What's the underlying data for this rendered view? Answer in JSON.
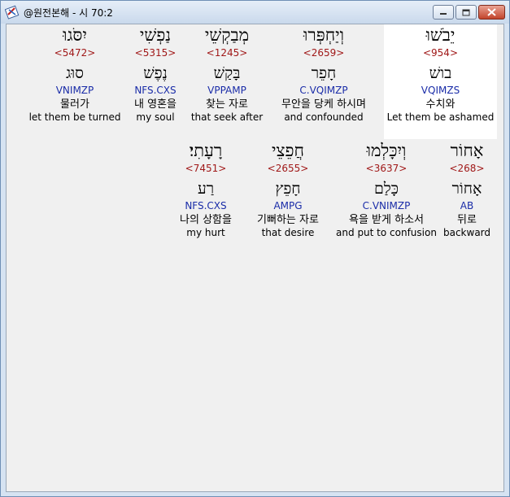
{
  "window": {
    "title": "@원전본해 - 시 70:2",
    "icon": "bible-app-icon",
    "controls": [
      "minimize",
      "maximize",
      "close"
    ]
  },
  "words": [
    {
      "heb": "יֵבֹשׁוּ",
      "strong": "<954>",
      "root": "בושׁ",
      "morph": "VQIMZS",
      "kor": "수치와",
      "eng": "Let them be ashamed",
      "selected": true
    },
    {
      "heb": "וְיַחְפְּרוּ",
      "strong": "<2659>",
      "root": "חָפֵר",
      "morph": "C.VQIMZP",
      "kor": "무안을 당케 하시며",
      "eng": "and confounded"
    },
    {
      "heb": "מְבַקְשֵׁי",
      "strong": "<1245>",
      "root": "בָּקַשׁ",
      "morph": "VPPAMP",
      "kor": "찾는 자로",
      "eng": "that seek after"
    },
    {
      "heb": "נַפְשִׁי",
      "strong": "<5315>",
      "root": "נֶפֶשׁ",
      "morph": "NFS.CXS",
      "kor": "내 영혼을",
      "eng": "my soul"
    },
    {
      "heb": "יִסֹּגוּ",
      "strong": "<5472>",
      "root": "סוּג",
      "morph": "VNIMZP",
      "kor": "물러가",
      "eng": "let them be turned"
    },
    {
      "heb": "אָחוֹר",
      "strong": "<268>",
      "root": "אָחוֹר",
      "morph": "AB",
      "kor": "뒤로",
      "eng": "backward"
    },
    {
      "heb": "וְיִכָּלְמוּ",
      "strong": "<3637>",
      "root": "כָּלַם",
      "morph": "C.VNIMZP",
      "kor": "욕을 받게 하소서",
      "eng": "and put to confusion"
    },
    {
      "heb": "חֲפֵצֵי",
      "strong": "<2655>",
      "root": "חָפֵץ",
      "morph": "AMPG",
      "kor": "기뻐하는 자로",
      "eng": "that desire"
    },
    {
      "heb": "רָעָתִי׃",
      "strong": "<7451>",
      "root": "רַע",
      "morph": "NFS.CXS",
      "kor": "나의 상함을",
      "eng": "my hurt"
    }
  ]
}
